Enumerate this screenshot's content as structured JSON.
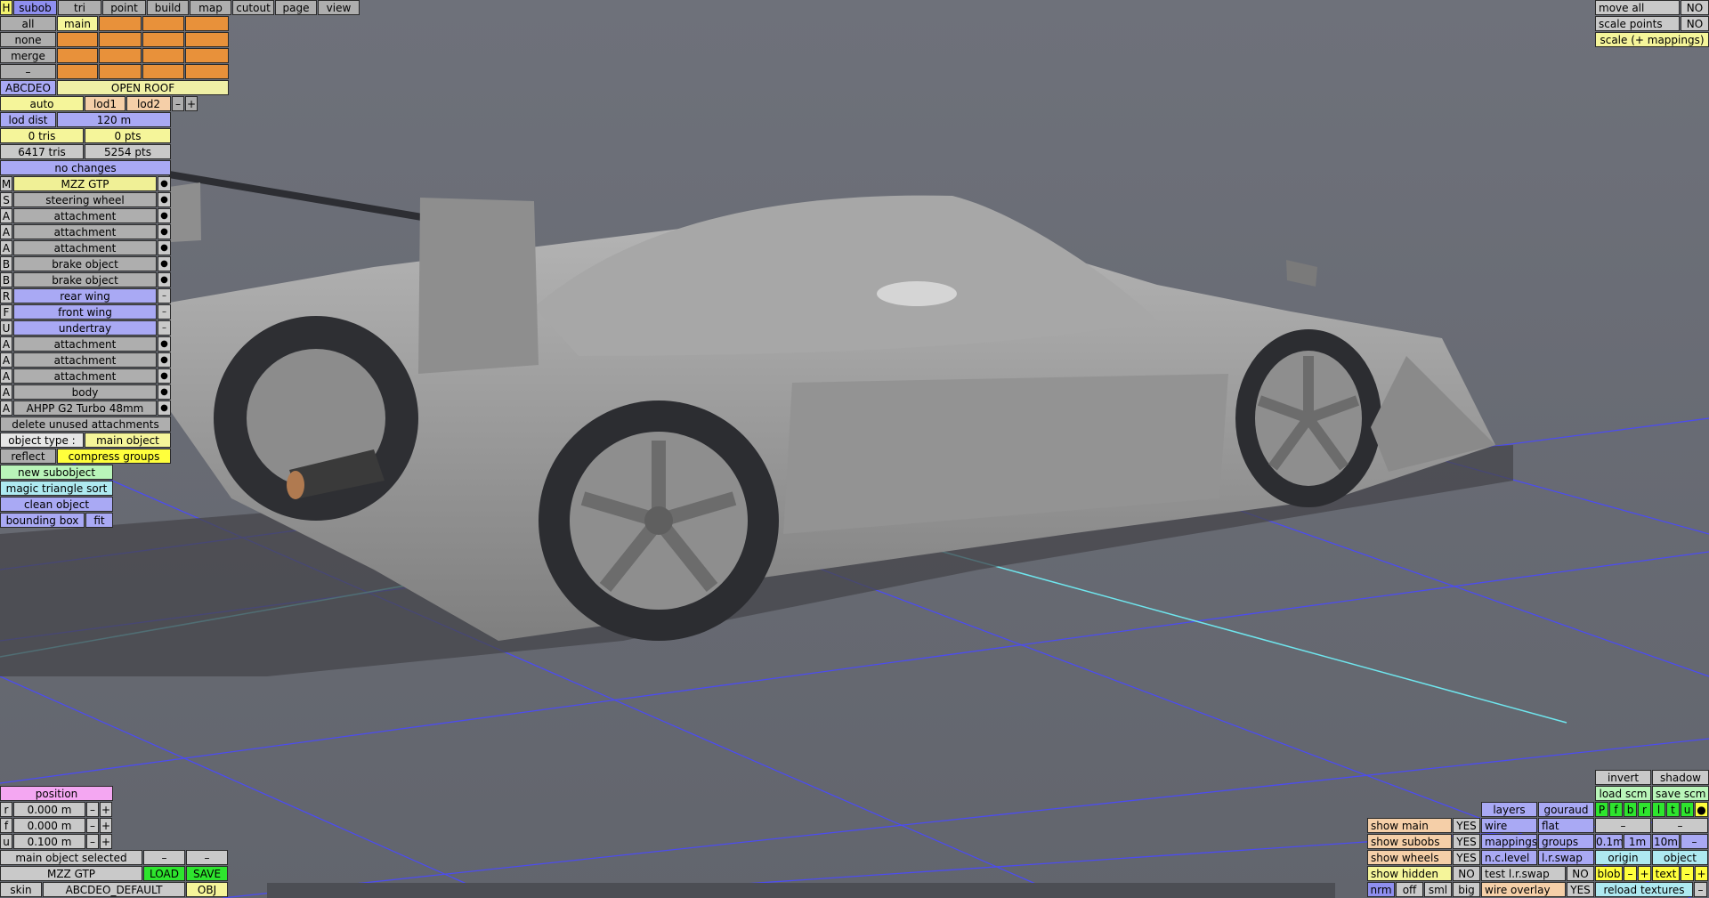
{
  "top_menu": {
    "h": "H",
    "tabs": [
      "subob",
      "tri",
      "point",
      "build",
      "map",
      "cutout",
      "page",
      "view"
    ],
    "active_tab": "subob"
  },
  "subob_grid": {
    "rows": [
      {
        "label": "all",
        "first": "main"
      },
      {
        "label": "none",
        "first": ""
      },
      {
        "label": "merge",
        "first": ""
      },
      {
        "label": "–",
        "first": ""
      }
    ]
  },
  "name_row": {
    "code": "ABCDEO",
    "name": "OPEN ROOF"
  },
  "lod": {
    "auto": "auto",
    "lod1": "lod1",
    "lod2": "lod2",
    "minus": "–",
    "plus": "+",
    "dist_label": "lod dist",
    "dist_value": "120 m"
  },
  "stats": {
    "tris_sel": "0 tris",
    "pts_sel": "0 pts",
    "tris_total": "6417 tris",
    "pts_total": "5254 pts",
    "changes": "no changes"
  },
  "objects": [
    {
      "type": "M",
      "name": "MZZ GTP",
      "mark": "●",
      "color": "sel"
    },
    {
      "type": "S",
      "name": "steering wheel",
      "mark": "●",
      "color": "gray"
    },
    {
      "type": "A",
      "name": "attachment",
      "mark": "●",
      "color": "gray"
    },
    {
      "type": "A",
      "name": "attachment",
      "mark": "●",
      "color": "gray"
    },
    {
      "type": "A",
      "name": "attachment",
      "mark": "●",
      "color": "gray"
    },
    {
      "type": "B",
      "name": "brake object",
      "mark": "●",
      "color": "gray"
    },
    {
      "type": "B",
      "name": "brake object",
      "mark": "●",
      "color": "gray"
    },
    {
      "type": "R",
      "name": "rear wing",
      "mark": "–",
      "color": "blue"
    },
    {
      "type": "F",
      "name": "front wing",
      "mark": "–",
      "color": "blue"
    },
    {
      "type": "U",
      "name": "undertray",
      "mark": "–",
      "color": "blue"
    },
    {
      "type": "A",
      "name": "attachment",
      "mark": "●",
      "color": "gray"
    },
    {
      "type": "A",
      "name": "attachment",
      "mark": "●",
      "color": "gray"
    },
    {
      "type": "A",
      "name": "attachment",
      "mark": "●",
      "color": "gray"
    },
    {
      "type": "A",
      "name": "body",
      "mark": "●",
      "color": "gray"
    },
    {
      "type": "A",
      "name": "AHPP G2 Turbo 48mm",
      "mark": "●",
      "color": "gray"
    }
  ],
  "actions": {
    "delete_unused": "delete unused attachments",
    "object_type_label": "object type :",
    "object_type_value": "main object",
    "reflect": "reflect",
    "compress": "compress groups",
    "new_subobject": "new subobject",
    "magic_sort": "magic triangle sort",
    "clean_object": "clean object",
    "bounding_box": "bounding box",
    "fit": "fit"
  },
  "position": {
    "title": "position",
    "rows": [
      {
        "axis": "r",
        "value": "0.000 m"
      },
      {
        "axis": "f",
        "value": "0.000 m"
      },
      {
        "axis": "u",
        "value": "0.100 m"
      }
    ],
    "minus": "–",
    "plus": "+"
  },
  "bottom_left": {
    "selected": "main object selected",
    "dash1": "–",
    "dash2": "–",
    "object_name": "MZZ GTP",
    "load": "LOAD",
    "save": "SAVE",
    "skin_label": "skin",
    "skin_value": "ABCDEO_DEFAULT",
    "obj": "OBJ"
  },
  "top_right": [
    {
      "label": "move all",
      "value": "NO"
    },
    {
      "label": "scale points",
      "value": "NO"
    }
  ],
  "scale_mappings": "scale (+ mappings)",
  "bottom_right": {
    "invert": "invert",
    "shadow": "shadow",
    "load_scm": "load scm",
    "save_scm": "save scm",
    "layers": "layers",
    "gouraud": "gouraud",
    "layer_letters": [
      "P",
      "f",
      "b",
      "r",
      "l",
      "t",
      "u"
    ],
    "layer_dot": "●",
    "show_rows": [
      {
        "label": "show main",
        "value": "YES",
        "mid": "wire",
        "right": "flat"
      },
      {
        "label": "show subobs",
        "value": "YES",
        "mid": "mappings",
        "right": "groups"
      },
      {
        "label": "show wheels",
        "value": "YES",
        "mid": "n.c.level",
        "right": "l.r.swap"
      },
      {
        "label": "show hidden",
        "value": "NO",
        "mid": "test l.r.swap",
        "right": "NO"
      }
    ],
    "dash": "–",
    "scales": [
      "0.1m",
      "1m",
      "10m"
    ],
    "origin": "origin",
    "object": "object",
    "blob": "blob",
    "text": "text",
    "minus": "–",
    "plus": "+",
    "view_modes": [
      "nrm",
      "off",
      "sml",
      "big"
    ],
    "wire_overlay": "wire overlay",
    "wire_overlay_value": "YES",
    "reload_textures": "reload textures"
  },
  "colors": {
    "background": "#696c74",
    "grid": "#4d4df0",
    "axis": "#6fe6ee",
    "car": "#9c9c9c"
  }
}
